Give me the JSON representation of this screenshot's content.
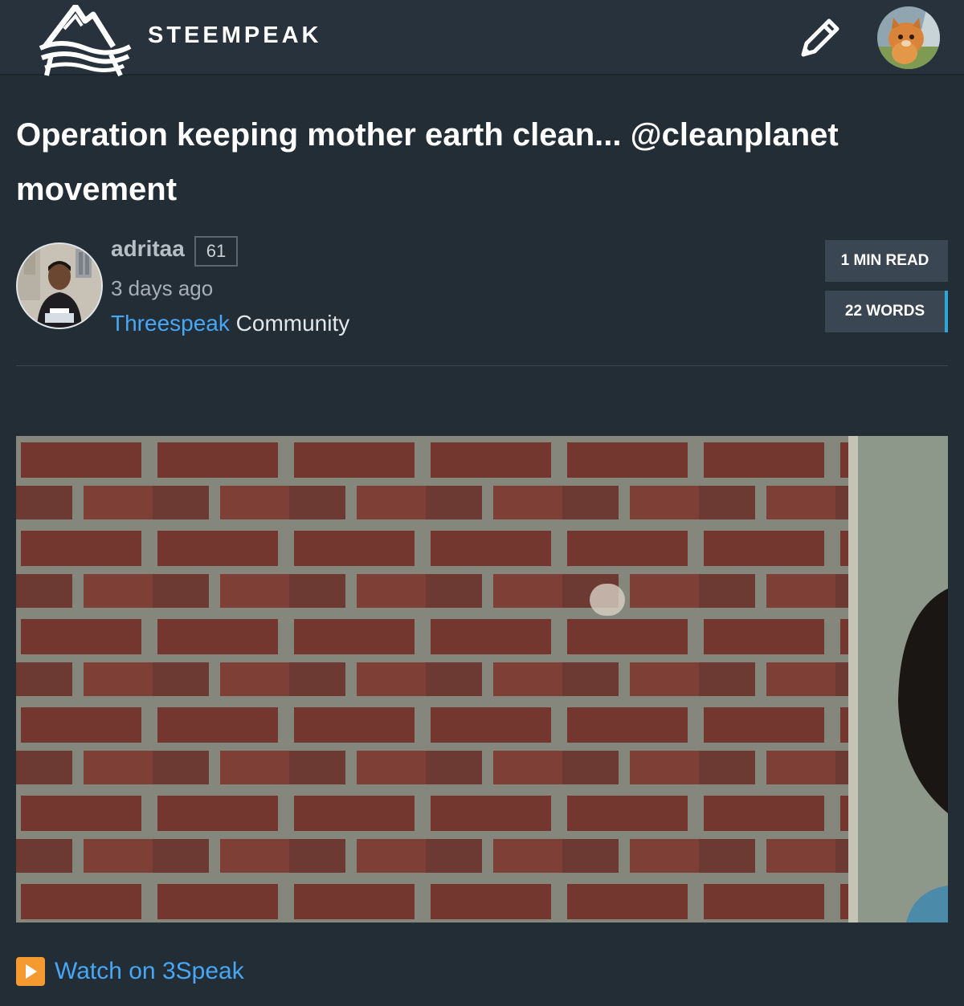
{
  "header": {
    "brand": "STEEMPEAK",
    "logo_icon": "mountain-wave-logo",
    "edit_icon": "pencil-icon",
    "user_avatar_icon": "kitten-avatar"
  },
  "post": {
    "title": "Operation keeping mother earth clean... @cleanplanet movement",
    "author": "adritaa",
    "reputation": "61",
    "time_ago": "3 days ago",
    "community_link": "Threespeak",
    "community_suffix": " Community",
    "read_time": "1 MIN READ",
    "word_count": "22 WORDS"
  },
  "media": {
    "video_thumbnail": "brick-wall-video-thumbnail",
    "watch_icon": "play-button-icon",
    "watch_label": "Watch on 3Speak"
  },
  "colors": {
    "background": "#232d36",
    "topbar": "#27323c",
    "link": "#47a7f5",
    "badge": "#3a4651",
    "badge_accent": "#2fa6d6",
    "play": "#f59a30"
  }
}
